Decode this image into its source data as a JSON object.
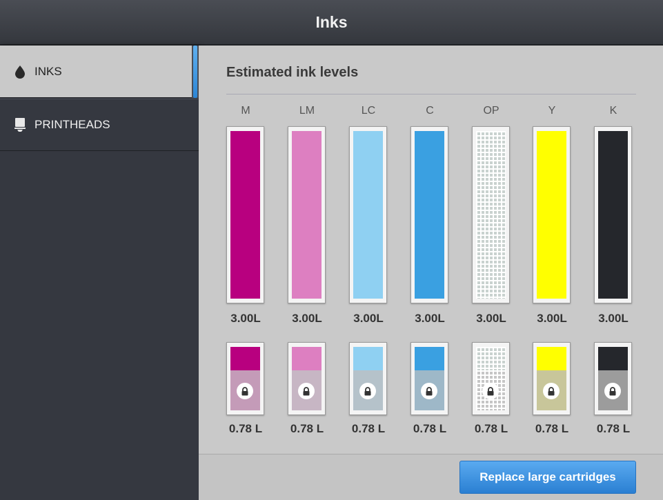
{
  "window": {
    "title": "Inks"
  },
  "sidebar": {
    "items": [
      {
        "label": "INKS",
        "icon": "ink-drop-icon",
        "active": true
      },
      {
        "label": "PRINTHEADS",
        "icon": "printhead-icon",
        "active": false
      }
    ]
  },
  "main": {
    "section_title": "Estimated ink levels",
    "inks": [
      {
        "code": "M",
        "large_volume": "3.00L",
        "small_volume": "0.78 L",
        "color": "#b8007f",
        "small_bottom_color": "#c49bb8"
      },
      {
        "code": "LM",
        "large_volume": "3.00L",
        "small_volume": "0.78 L",
        "color": "#dd7fc1",
        "small_bottom_color": "#c7b6c4"
      },
      {
        "code": "LC",
        "large_volume": "3.00L",
        "small_volume": "0.78 L",
        "color": "#8fd0f2",
        "small_bottom_color": "#b5c2ca"
      },
      {
        "code": "C",
        "large_volume": "3.00L",
        "small_volume": "0.78 L",
        "color": "#3aa0e1",
        "small_bottom_color": "#9eb8c8"
      },
      {
        "code": "OP",
        "large_volume": "3.00L",
        "small_volume": "0.78 L",
        "color": "#ffffff",
        "small_bottom_color": "#c6c6c6"
      },
      {
        "code": "Y",
        "large_volume": "3.00L",
        "small_volume": "0.78 L",
        "color": "#ffff00",
        "small_bottom_color": "#c8c69a"
      },
      {
        "code": "K",
        "large_volume": "3.00L",
        "small_volume": "0.78 L",
        "color": "#25272c",
        "small_bottom_color": "#9c9c9c"
      }
    ]
  },
  "footer": {
    "replace_button": "Replace large cartridges"
  }
}
